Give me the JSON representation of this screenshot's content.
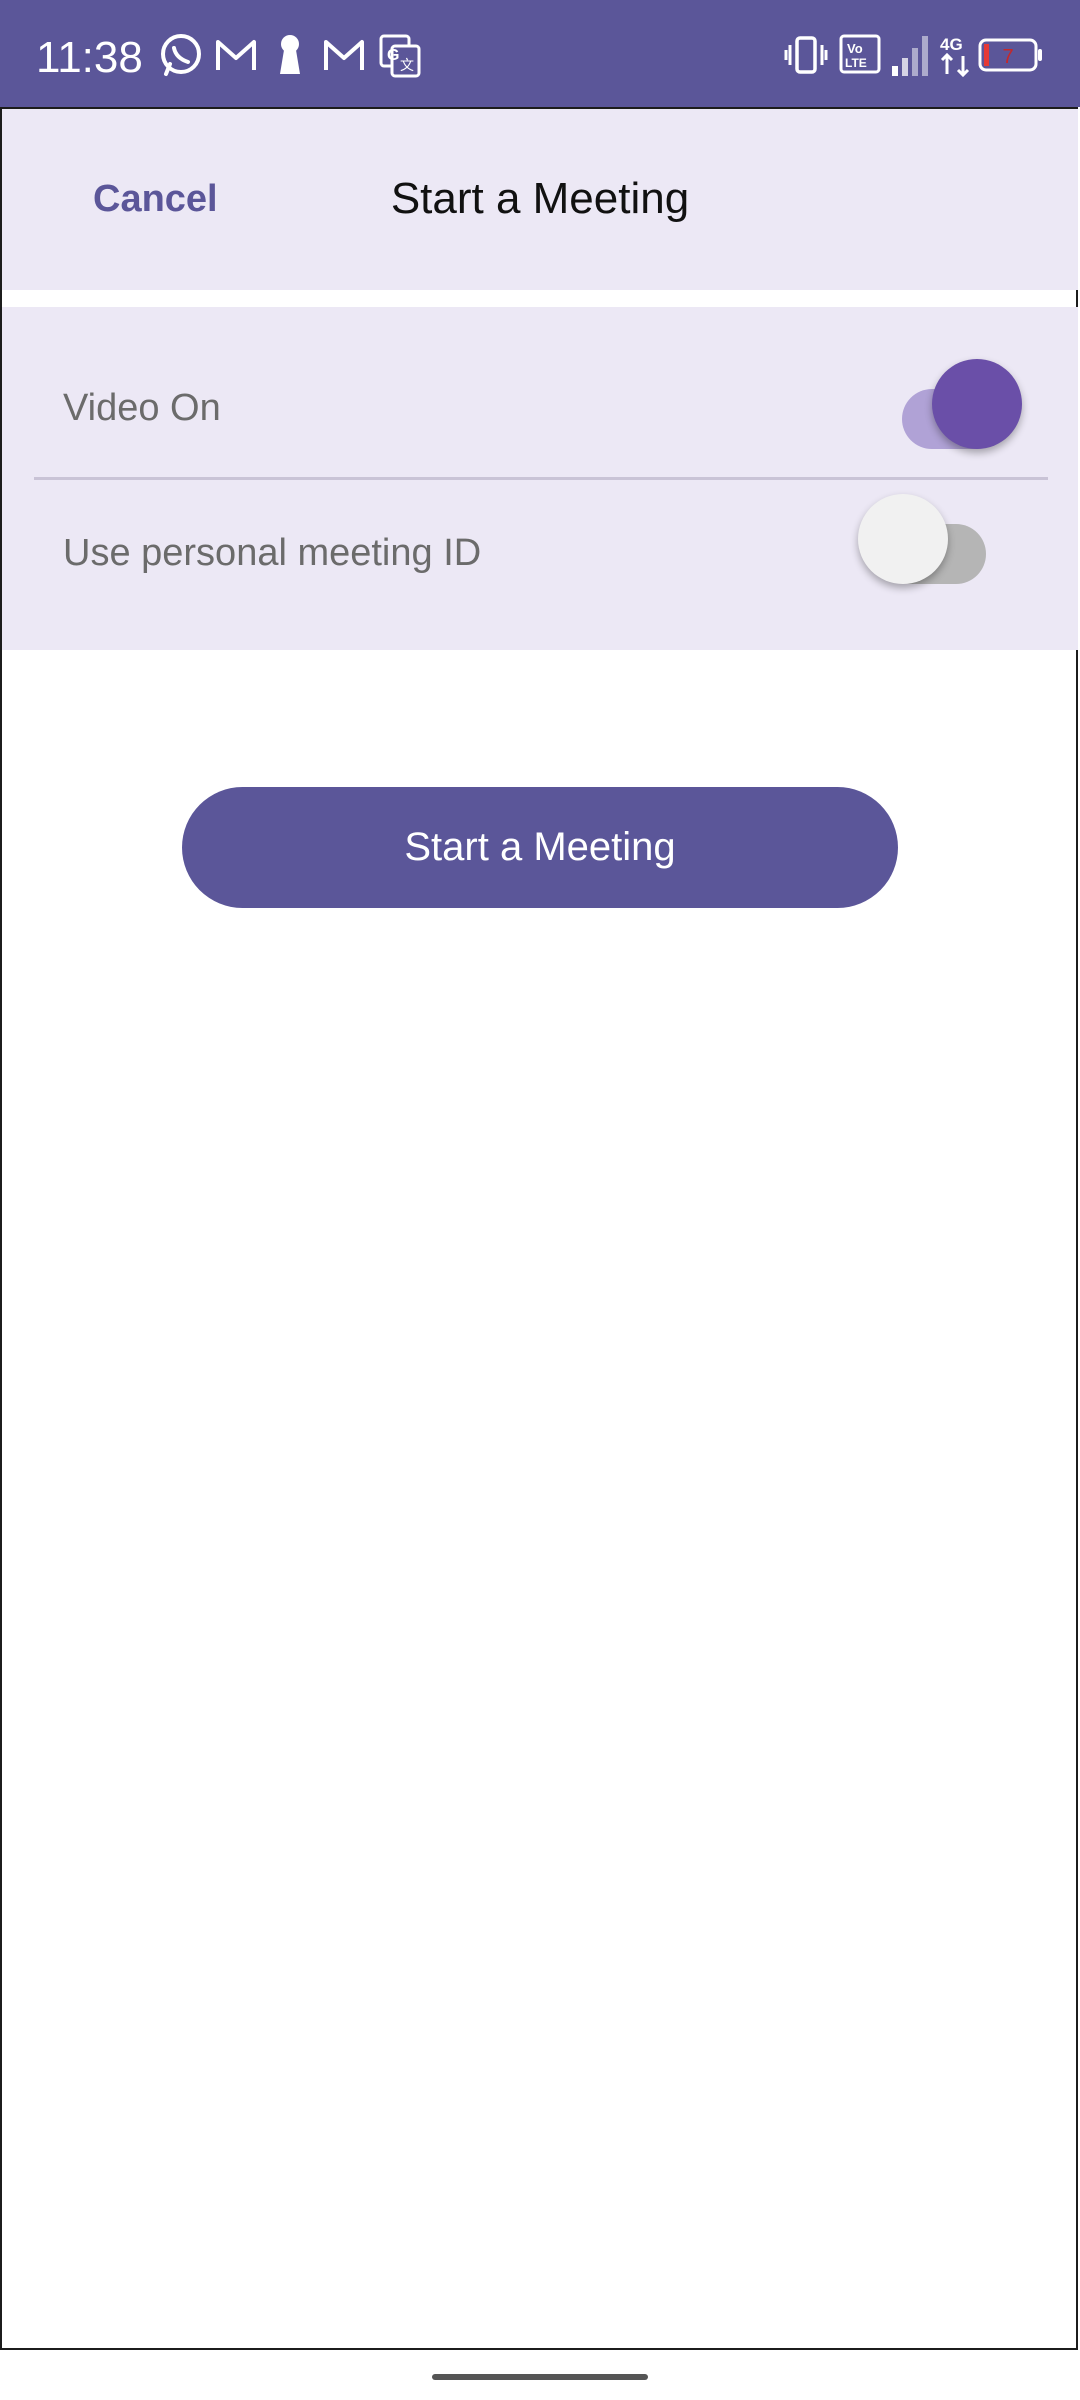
{
  "status_bar": {
    "time": "11:38",
    "left_icons": [
      "whatsapp-icon",
      "gmail-icon",
      "keyhole-icon",
      "gmail-icon",
      "translate-icon"
    ],
    "right_icons": [
      "vibrate-icon",
      "volte-icon",
      "signal-icon",
      "4g-data-icon",
      "battery-icon"
    ],
    "battery_level": "7",
    "background_color": "#5b5699"
  },
  "header": {
    "cancel_label": "Cancel",
    "title": "Start a Meeting"
  },
  "settings": {
    "video_on": {
      "label": "Video On",
      "enabled": true
    },
    "personal_meeting_id": {
      "label": "Use personal meeting ID",
      "enabled": false
    }
  },
  "actions": {
    "start_label": "Start a Meeting"
  },
  "colors": {
    "accent": "#5b5699",
    "toggle_on_thumb": "#6a4fa8",
    "toggle_on_track": "#b0a2d6",
    "toggle_off_thumb": "#f1f1f1",
    "toggle_off_track": "#b5b5b5",
    "panel_background": "#ece8f5"
  }
}
